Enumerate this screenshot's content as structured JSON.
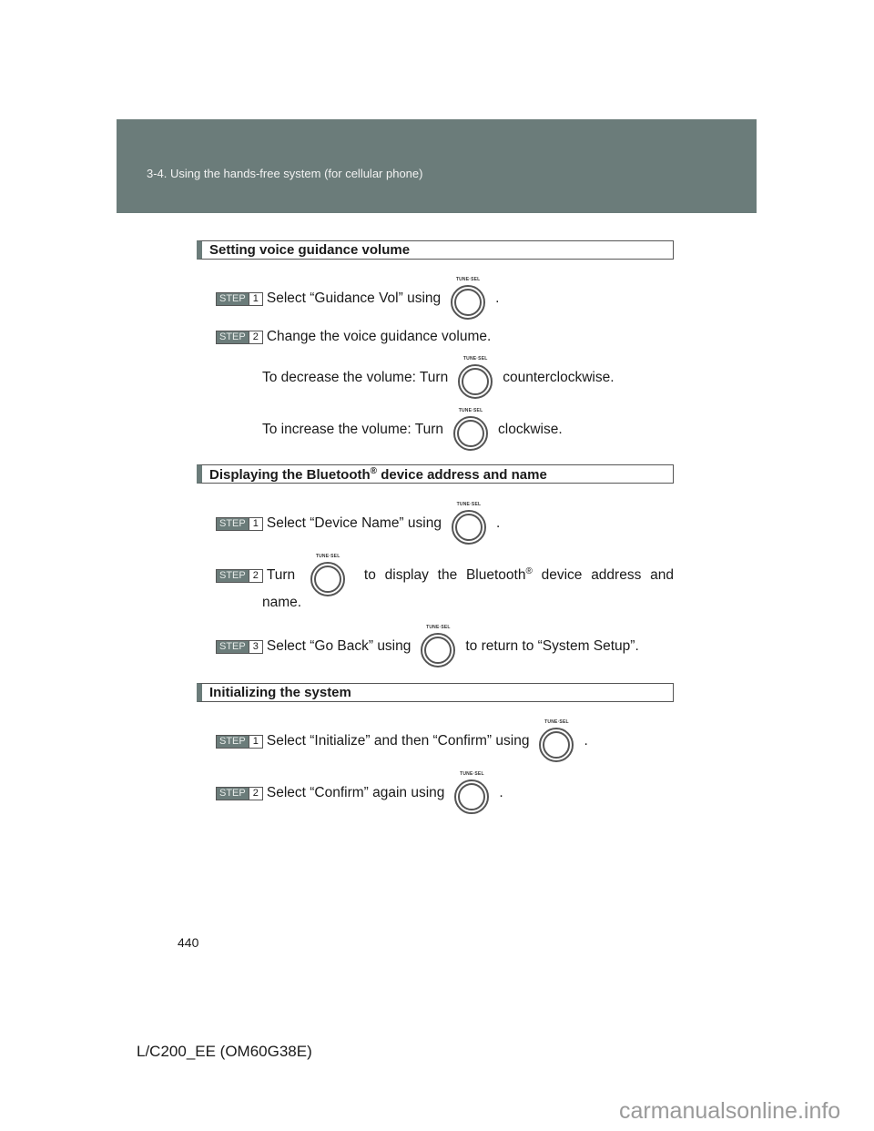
{
  "header": {
    "section_title": "3-4. Using the hands-free system (for cellular phone)"
  },
  "knob_label": "TUNE·SEL",
  "step_label": "STEP",
  "sections": [
    {
      "title": "Setting voice guidance volume",
      "steps": [
        {
          "num": "1",
          "before": "Select “Guidance Vol” using",
          "after": "."
        },
        {
          "num": "2",
          "text": "Change the voice guidance volume."
        }
      ],
      "sub": [
        {
          "before": "To decrease the volume: Turn",
          "after": "counterclockwise."
        },
        {
          "before": "To increase the volume: Turn",
          "after": "clockwise."
        }
      ]
    },
    {
      "title": "Displaying the Bluetooth",
      "title_sup": "®",
      "title_rest": " device address and name",
      "steps": [
        {
          "num": "1",
          "before": "Select “Device Name” using",
          "after": "."
        },
        {
          "num": "2",
          "before": "Turn",
          "mid1": "to",
          "mid2": "display",
          "mid3": "the",
          "mid4": "Bluetooth",
          "sup": "®",
          "mid5": "device",
          "mid6": "address",
          "mid7": "and",
          "cont": "name."
        },
        {
          "num": "3",
          "before": "Select “Go Back” using",
          "after": "to return to “System Setup”."
        }
      ]
    },
    {
      "title": "Initializing the system",
      "steps": [
        {
          "num": "1",
          "before": "Select “Initialize” and then “Confirm” using",
          "after": "."
        },
        {
          "num": "2",
          "before": "Select “Confirm” again using",
          "after": "."
        }
      ]
    }
  ],
  "footer": {
    "page_number": "440",
    "model_code": "L/C200_EE (OM60G38E)",
    "watermark": "carmanualsonline.info"
  }
}
